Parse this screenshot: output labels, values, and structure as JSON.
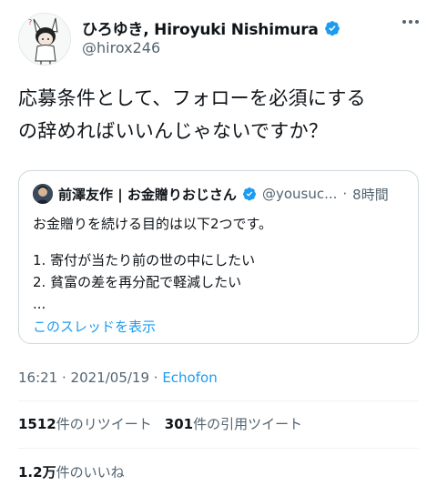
{
  "author": {
    "display_name": "ひろゆき, Hiroyuki Nishimura",
    "handle": "@hirox246",
    "verified_icon": "verified-badge-icon",
    "avatar_icon": "cartoon-avatar-icon"
  },
  "tweet": {
    "text_line1": "応募条件として、フォローを必須にする",
    "text_line2": "の辞めればいいんじゃないですか？"
  },
  "quote": {
    "display_name": "前澤友作 | お金贈りおじさん",
    "handle": "@yousuc...",
    "dot": "·",
    "time": "8時間",
    "body_line1": "お金贈りを続ける目的は以下2つです。",
    "body_line2": "1. 寄付が当たり前の世の中にしたい",
    "body_line3": "2. 貧富の差を再分配で軽減したい",
    "body_line4": "...",
    "show_thread": "このスレッドを表示"
  },
  "meta": {
    "time": "16:21",
    "sep1": " · ",
    "date": "2021/05/19",
    "sep2": " · ",
    "source": "Echofon"
  },
  "stats": {
    "retweets_count": "1512",
    "retweets_label": "件のリツイート",
    "quotes_count": "301",
    "quotes_label": "件の引用ツイート",
    "likes_count": "1.2万",
    "likes_label": "件のいいね"
  },
  "colors": {
    "accent": "#1d9bf0",
    "secondary_text": "#536471",
    "border": "#cfd9de"
  }
}
